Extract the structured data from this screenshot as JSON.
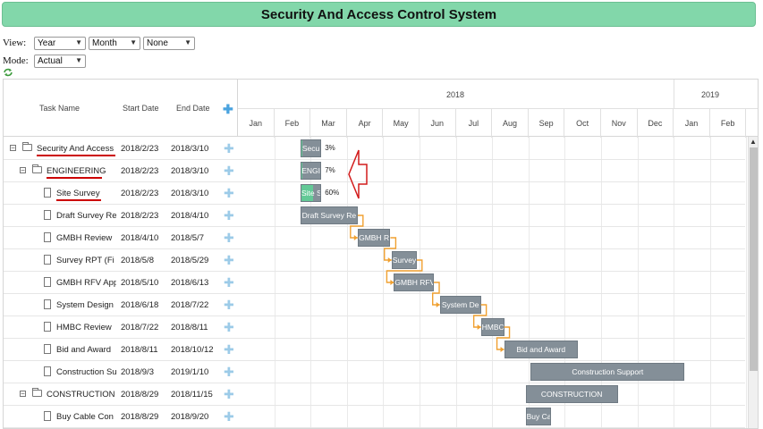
{
  "title": "Security And Access Control System",
  "controls": {
    "view_label": "View:",
    "mode_label": "Mode:",
    "view_options": [
      "Year",
      "Month",
      "None"
    ],
    "mode_value": "Actual"
  },
  "grid": {
    "columns": [
      "Task Name",
      "Start Date",
      "End Date"
    ],
    "add_icon": "plus-icon"
  },
  "scale": {
    "years": [
      "2018",
      "2019"
    ],
    "months": [
      "Jan",
      "Feb",
      "Mar",
      "Apr",
      "May",
      "Jun",
      "Jul",
      "Aug",
      "Sep",
      "Oct",
      "Nov",
      "Dec",
      "Jan",
      "Feb"
    ]
  },
  "tasks": [
    {
      "name": "Security And Access",
      "start": "2018/2/23",
      "end": "2018/3/10",
      "bar_label": "Secu",
      "percent": "3%",
      "progress": 0.03,
      "level": 0,
      "type": "project"
    },
    {
      "name": "ENGINEERING",
      "start": "2018/2/23",
      "end": "2018/3/10",
      "bar_label": "ENGI",
      "percent": "7%",
      "progress": 0.07,
      "level": 1,
      "type": "project"
    },
    {
      "name": "Site Survey",
      "start": "2018/2/23",
      "end": "2018/3/10",
      "bar_label": "Site S",
      "percent": "60%",
      "progress": 0.6,
      "level": 2,
      "type": "task"
    },
    {
      "name": "Draft Survey Re",
      "start": "2018/2/23",
      "end": "2018/4/10",
      "bar_label": "Draft Survey Re",
      "percent": "",
      "progress": 0,
      "level": 2,
      "type": "task"
    },
    {
      "name": "GMBH Review",
      "start": "2018/4/10",
      "end": "2018/5/7",
      "bar_label": "GMBH R",
      "percent": "",
      "progress": 0,
      "level": 2,
      "type": "task"
    },
    {
      "name": "Survey RPT (Fi",
      "start": "2018/5/8",
      "end": "2018/5/29",
      "bar_label": "Survey",
      "percent": "",
      "progress": 0,
      "level": 2,
      "type": "task"
    },
    {
      "name": "GMBH RFV App",
      "start": "2018/5/10",
      "end": "2018/6/13",
      "bar_label": "GMBH RFV",
      "percent": "",
      "progress": 0,
      "level": 2,
      "type": "task"
    },
    {
      "name": "System Design",
      "start": "2018/6/18",
      "end": "2018/7/22",
      "bar_label": "System De",
      "percent": "",
      "progress": 0,
      "level": 2,
      "type": "task"
    },
    {
      "name": "HMBC Review",
      "start": "2018/7/22",
      "end": "2018/8/11",
      "bar_label": "HMBC",
      "percent": "",
      "progress": 0,
      "level": 2,
      "type": "task"
    },
    {
      "name": "Bid and Award",
      "start": "2018/8/11",
      "end": "2018/10/12",
      "bar_label": "Bid and Award",
      "percent": "",
      "progress": 0,
      "level": 2,
      "type": "task"
    },
    {
      "name": "Construction Su",
      "start": "2018/9/3",
      "end": "2019/1/10",
      "bar_label": "Construction Support",
      "percent": "",
      "progress": 0,
      "level": 2,
      "type": "task"
    },
    {
      "name": "CONSTRUCTION",
      "start": "2018/8/29",
      "end": "2018/11/15",
      "bar_label": "CONSTRUCTION",
      "percent": "",
      "progress": 0,
      "level": 1,
      "type": "project"
    },
    {
      "name": "Buy Cable Con",
      "start": "2018/8/29",
      "end": "2018/9/20",
      "bar_label": "Buy Ca",
      "percent": "",
      "progress": 0,
      "level": 2,
      "type": "task"
    }
  ]
}
